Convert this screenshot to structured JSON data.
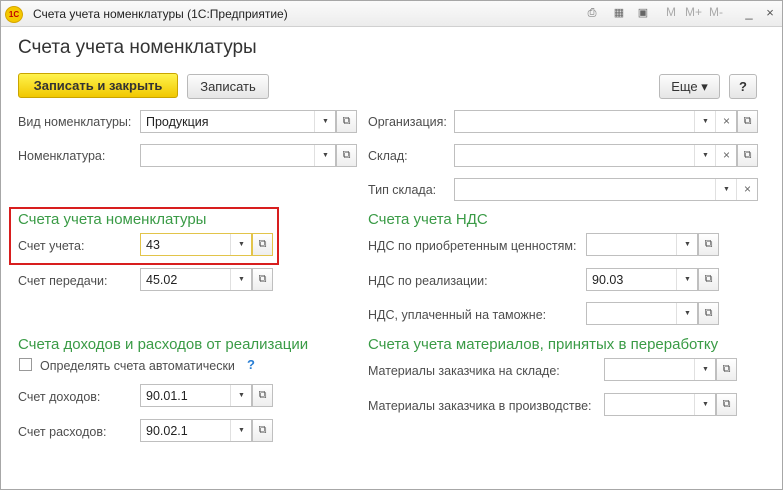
{
  "window": {
    "title": "Счета учета номенклатуры  (1С:Предприятие)",
    "logo": "1С",
    "m_buttons": [
      "M",
      "M+",
      "M-"
    ],
    "minimize": "_",
    "maximize": "□",
    "close": "×"
  },
  "form": {
    "title": "Счета учета номенклатуры",
    "save_close_label": "Записать и закрыть",
    "save_label": "Записать",
    "more_label": "Еще ▾",
    "help_label": "?"
  },
  "top_fields": {
    "vid_label": "Вид номенклатуры:",
    "vid_value": "Продукция",
    "nomenklatura_label": "Номенклатура:",
    "nomenklatura_value": "",
    "org_label": "Организация:",
    "org_value": "",
    "sklad_label": "Склад:",
    "sklad_value": "",
    "tip_sklada_label": "Тип склада:",
    "tip_sklada_value": ""
  },
  "accounts": {
    "title": "Счета учета номенклатуры",
    "schet_ucheta_label": "Счет учета:",
    "schet_ucheta_value": "43",
    "schet_peredachi_label": "Счет передачи:",
    "schet_peredachi_value": "45.02"
  },
  "income": {
    "title": "Счета доходов и расходов от реализации",
    "auto_label": "Определять счета автоматически",
    "auto_help": "?",
    "dohodov_label": "Счет доходов:",
    "dohodov_value": "90.01.1",
    "rashodov_label": "Счет расходов:",
    "rashodov_value": "90.02.1"
  },
  "vat": {
    "title": "Счета учета НДС",
    "acquired_label": "НДС по приобретенным ценностям:",
    "acquired_value": "",
    "sales_label": "НДС по реализации:",
    "sales_value": "90.03",
    "customs_label": "НДС, уплаченный на таможне:",
    "customs_value": ""
  },
  "materials": {
    "title": "Счета учета материалов, принятых в переработку",
    "warehouse_label": "Материалы заказчика на складе:",
    "warehouse_value": "",
    "production_label": "Материалы заказчика в производстве:",
    "production_value": ""
  },
  "icons": {
    "dropdown": "▼",
    "clear": "×",
    "open": "⧉"
  }
}
